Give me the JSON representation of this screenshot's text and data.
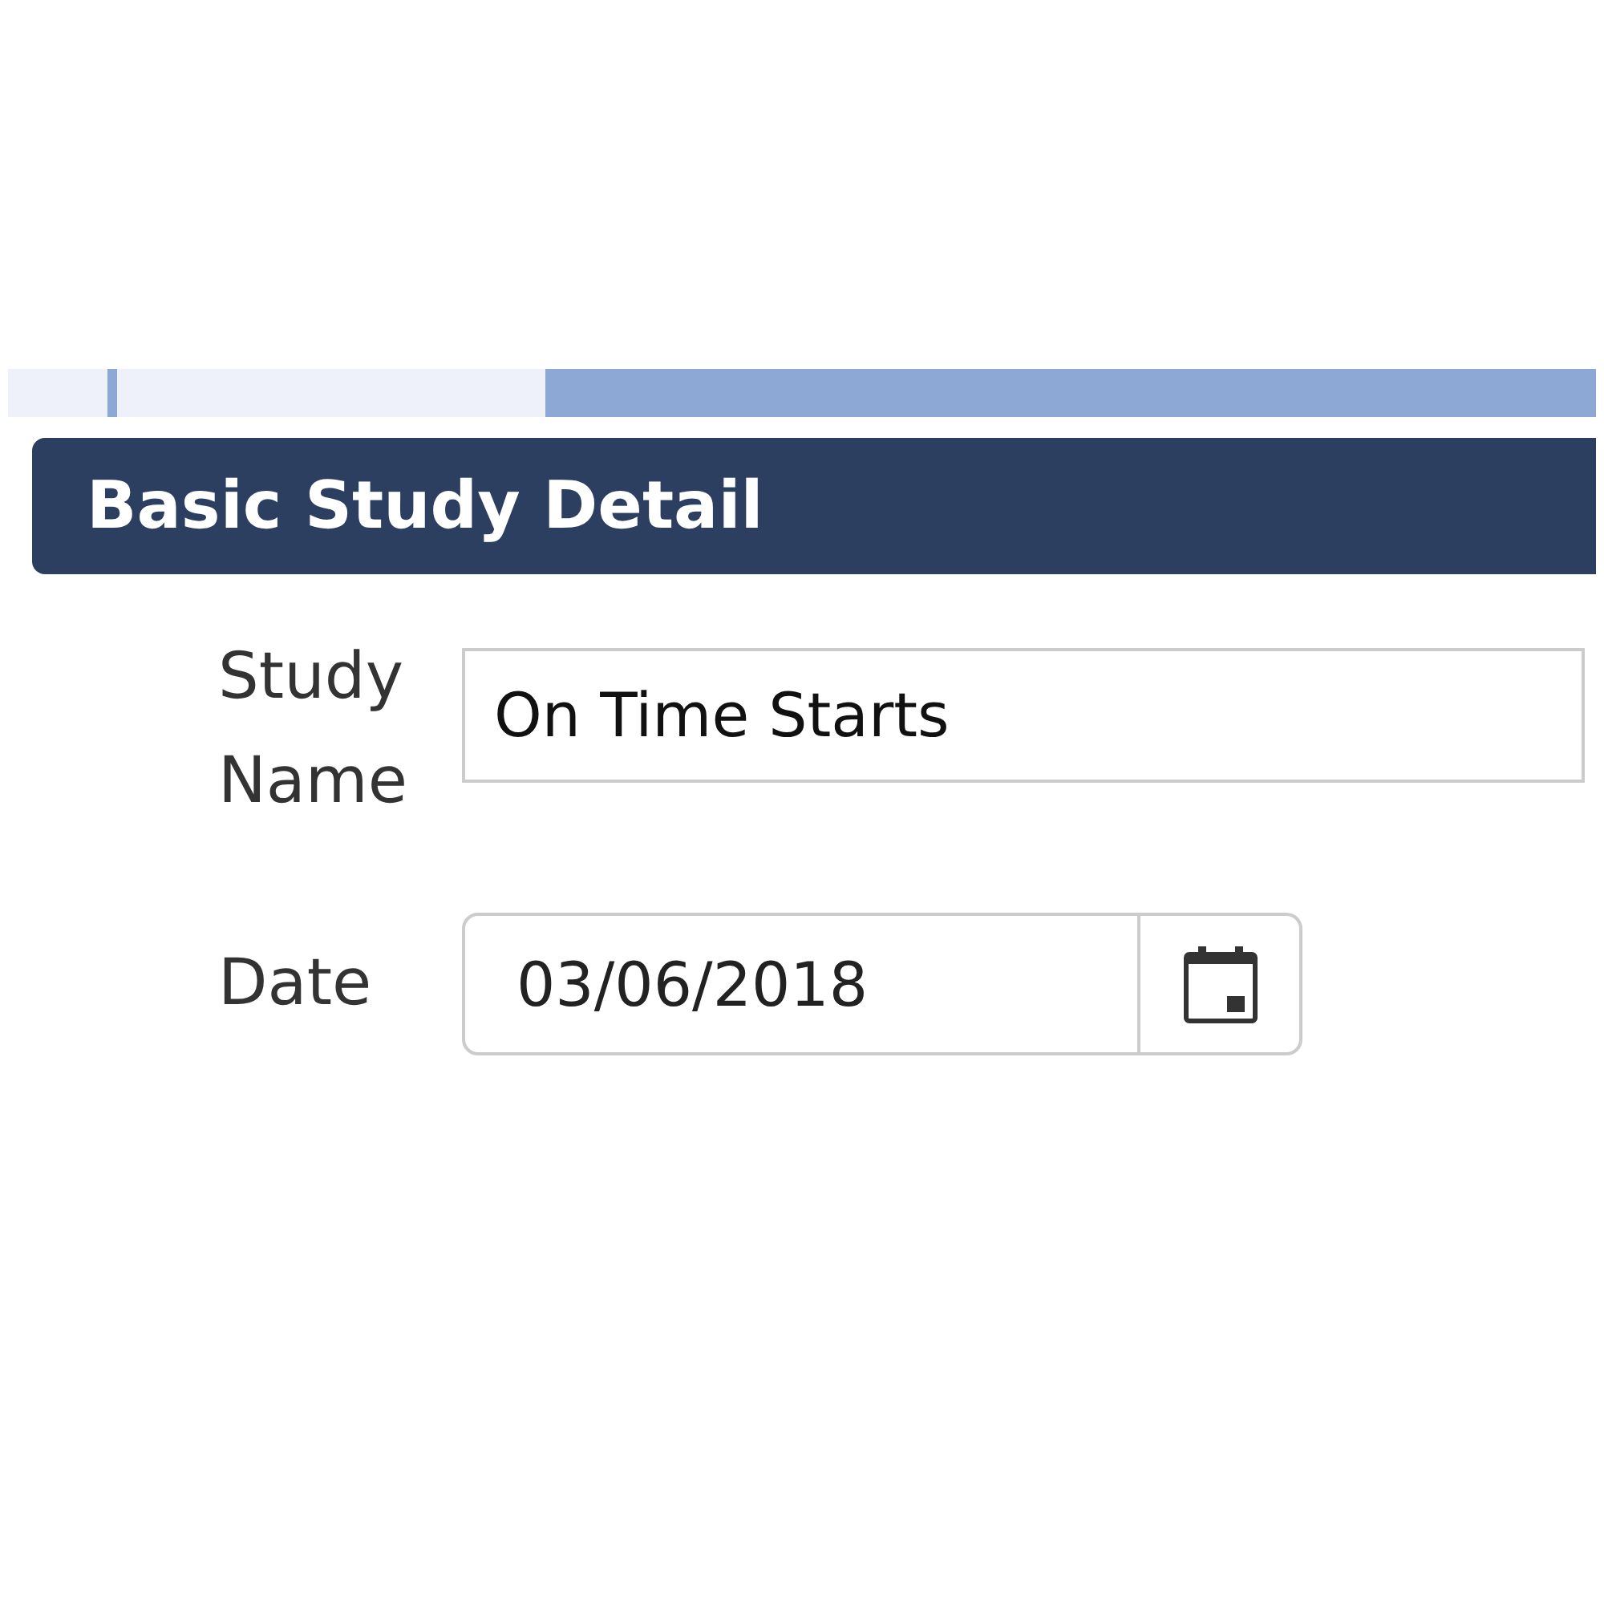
{
  "section": {
    "title": "Basic Study Detail"
  },
  "fields": [
    {
      "kind": "text",
      "label": "Study Name",
      "value": "On Time Starts"
    },
    {
      "kind": "date",
      "label": "Date",
      "value": "03/06/2018"
    }
  ]
}
